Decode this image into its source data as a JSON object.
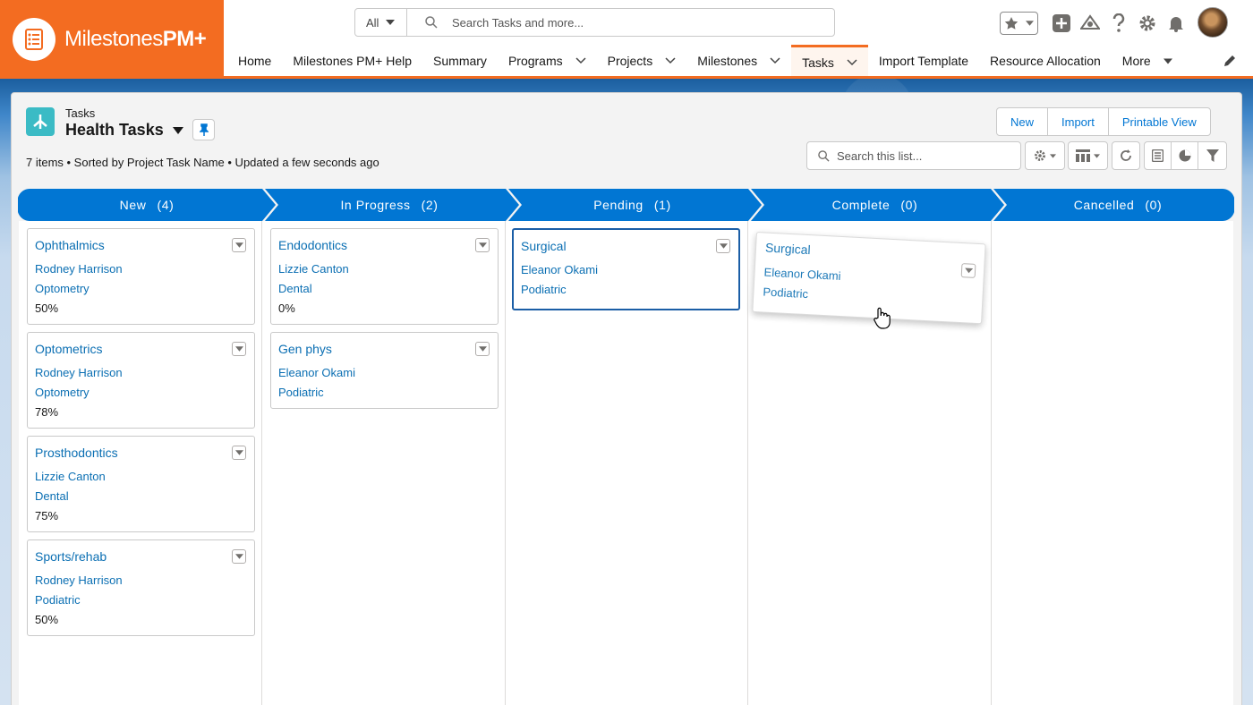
{
  "brand": {
    "name_light": "Milestones",
    "name_bold": "PM+"
  },
  "search": {
    "scope": "All",
    "placeholder": "Search Tasks and more..."
  },
  "nav": {
    "items": [
      {
        "label": "Home",
        "dropdown": false
      },
      {
        "label": "Milestones PM+ Help",
        "dropdown": false
      },
      {
        "label": "Summary",
        "dropdown": false
      },
      {
        "label": "Programs",
        "dropdown": true
      },
      {
        "label": "Projects",
        "dropdown": true
      },
      {
        "label": "Milestones",
        "dropdown": true
      },
      {
        "label": "Tasks",
        "dropdown": true,
        "active": true
      },
      {
        "label": "Import Template",
        "dropdown": false
      },
      {
        "label": "Resource Allocation",
        "dropdown": false
      },
      {
        "label": "More",
        "dropdown": true
      }
    ]
  },
  "list": {
    "object_label": "Tasks",
    "title": "Health Tasks",
    "meta": "7 items • Sorted by Project Task Name • Updated a few seconds ago",
    "buttons": {
      "new": "New",
      "import": "Import",
      "printable": "Printable View"
    },
    "search_placeholder": "Search this list..."
  },
  "stages": [
    {
      "label": "New",
      "count": "(4)"
    },
    {
      "label": "In Progress",
      "count": "(2)"
    },
    {
      "label": "Pending",
      "count": "(1)"
    },
    {
      "label": "Complete",
      "count": "(0)"
    },
    {
      "label": "Cancelled",
      "count": "(0)"
    }
  ],
  "columns": [
    {
      "cards": [
        {
          "title": "Ophthalmics",
          "owner": "Rodney Harrison",
          "dept": "Optometry",
          "pct": "50%"
        },
        {
          "title": "Optometrics",
          "owner": "Rodney Harrison",
          "dept": "Optometry",
          "pct": "78%"
        },
        {
          "title": "Prosthodontics",
          "owner": "Lizzie Canton",
          "dept": "Dental",
          "pct": "75%"
        },
        {
          "title": "Sports/rehab",
          "owner": "Rodney Harrison",
          "dept": "Podiatric",
          "pct": "50%"
        }
      ]
    },
    {
      "cards": [
        {
          "title": "Endodontics",
          "owner": "Lizzie Canton",
          "dept": "Dental",
          "pct": "0%"
        },
        {
          "title": "Gen phys",
          "owner": "Eleanor Okami",
          "dept": "Podiatric"
        }
      ]
    },
    {
      "cards": [
        {
          "title": "Surgical",
          "owner": "Eleanor Okami",
          "dept": "Podiatric",
          "selected": true
        }
      ]
    },
    {
      "cards": []
    },
    {
      "cards": []
    }
  ],
  "drag_ghost": {
    "title": "Surgical",
    "owner": "Eleanor Okami",
    "dept": "Podiatric"
  },
  "colors": {
    "brand_orange": "#f36c21",
    "path_blue": "#0176d3",
    "link_blue": "#0b6fb3"
  },
  "icons": [
    "checklist-logo-icon",
    "search-icon",
    "star-icon",
    "add-icon",
    "trailhead-icon",
    "help-icon",
    "gear-icon",
    "bell-icon",
    "pencil-icon",
    "pin-icon",
    "settings-icon",
    "table-icon",
    "refresh-icon",
    "chart-icon",
    "filter-icon",
    "hand-cursor-icon"
  ]
}
